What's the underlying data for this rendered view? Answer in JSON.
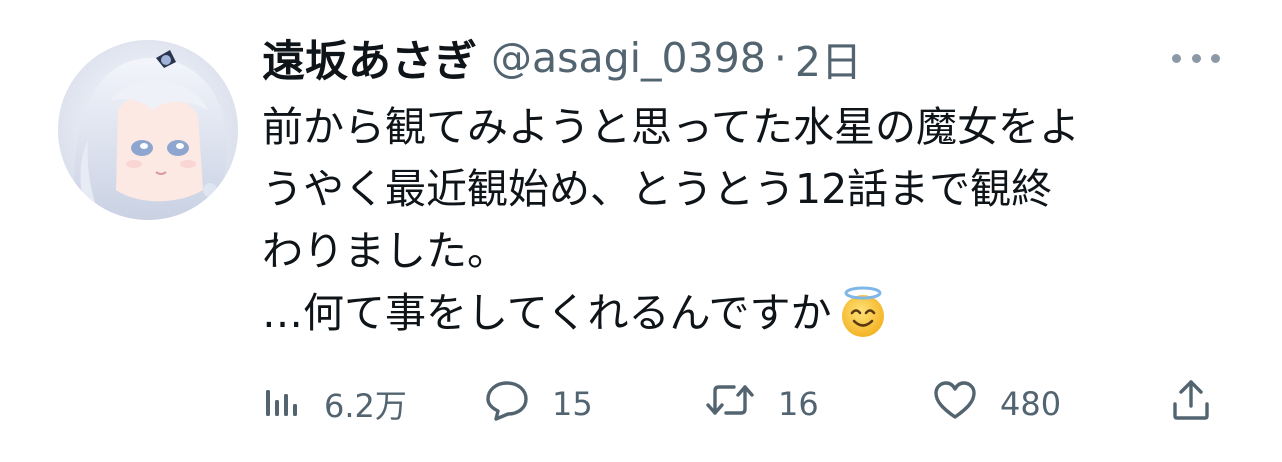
{
  "tweet": {
    "display_name": "遠坂あさぎ",
    "handle": "@asagi_0398",
    "separator": "·",
    "time": "2日",
    "body_lines": [
      "前から観てみようと思ってた水星の魔女をよ",
      "うやく最近観始め、とうとう12話まで観終",
      "わりました。",
      "…何て事をしてくれるんですか"
    ],
    "emoji": "smiling-face-with-halo"
  },
  "actions": {
    "views": {
      "icon": "views-bar-chart-icon",
      "count": "6.2万"
    },
    "reply": {
      "icon": "reply-bubble-icon",
      "count": "15"
    },
    "retweet": {
      "icon": "retweet-arrows-icon",
      "count": "16"
    },
    "like": {
      "icon": "heart-icon",
      "count": "480"
    },
    "share": {
      "icon": "share-upload-icon"
    }
  },
  "colors": {
    "text_primary": "#0f1419",
    "text_secondary": "#536471",
    "more_dots": "#8b98a5"
  }
}
